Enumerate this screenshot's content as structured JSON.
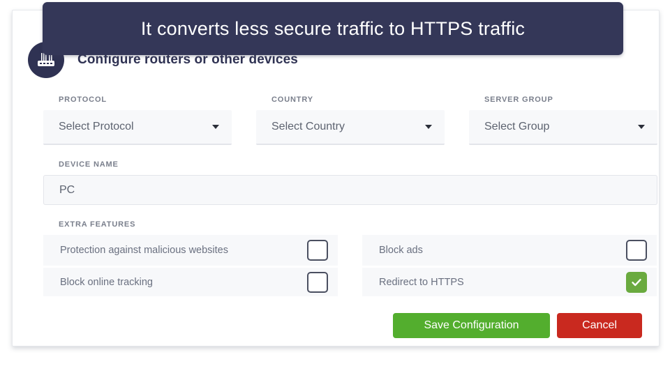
{
  "callout": {
    "text": "It converts less secure traffic to HTTPS traffic"
  },
  "header": {
    "icon": "router-icon",
    "title": "Configure routers or other devices"
  },
  "form": {
    "selects": [
      {
        "label": "PROTOCOL",
        "value": "Select Protocol",
        "name": "protocol"
      },
      {
        "label": "COUNTRY",
        "value": "Select Country",
        "name": "country"
      },
      {
        "label": "SERVER GROUP",
        "value": "Select Group",
        "name": "server-group"
      }
    ],
    "device_name": {
      "label": "DEVICE NAME",
      "value": "PC"
    },
    "extra_features": {
      "label": "EXTRA FEATURES",
      "left": [
        {
          "name": "Protection against malicious websites",
          "checked": false
        },
        {
          "name": "Block online tracking",
          "checked": false
        }
      ],
      "right": [
        {
          "name": "Block ads",
          "checked": false
        },
        {
          "name": "Redirect to HTTPS",
          "checked": true
        }
      ]
    }
  },
  "actions": {
    "save_label": "Save Configuration",
    "cancel_label": "Cancel"
  },
  "colors": {
    "callout_bg": "#343758",
    "accent_dark": "#2f3253",
    "save_green": "#53ae2e",
    "checked_green": "#6aaa3f",
    "cancel_red": "#c9291f",
    "field_bg": "#f7f8fa"
  }
}
